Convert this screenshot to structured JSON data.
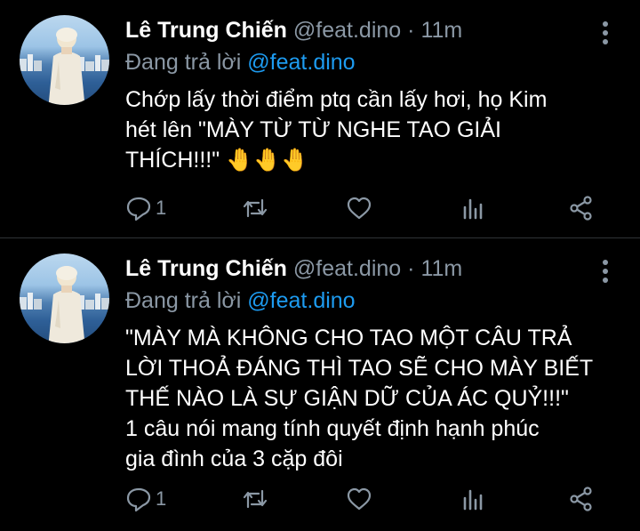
{
  "tweets": [
    {
      "author_name": "Lê Trung Chiến",
      "handle": "@feat.dino",
      "separator": "·",
      "time": "11m",
      "reply_prefix": "Đang trả lời",
      "reply_mention": "@feat.dino",
      "lines": [
        "Chớp lấy thời điểm ptq cần lấy hơi, họ Kim",
        "hét lên \"MÀY TỪ TỪ NGHE TAO GIẢI",
        "THÍCH!!!\" 🤚🤚🤚"
      ],
      "reply_count": "1"
    },
    {
      "author_name": "Lê Trung Chiến",
      "handle": "@feat.dino",
      "separator": "·",
      "time": "11m",
      "reply_prefix": "Đang trả lời",
      "reply_mention": "@feat.dino",
      "lines": [
        "\"MÀY MÀ KHÔNG CHO TAO MỘT CÂU TRẢ",
        "LỜI THOẢ ĐÁNG THÌ TAO SẼ CHO MÀY BIẾT",
        "THẾ NÀO LÀ SỰ GIẬN DỮ CỦA ÁC QUỶ!!!\"",
        "1 câu nói mang tính quyết định hạnh phúc",
        "gia đình của 3 cặp đôi"
      ],
      "reply_count": "1"
    }
  ],
  "icons": {
    "reply": "reply-icon",
    "retweet": "retweet-icon",
    "like": "heart-icon",
    "stats": "analytics-icon",
    "share": "share-icon",
    "more": "more-vertical-icon"
  },
  "colors": {
    "background": "#000000",
    "secondary_text": "#8b98a5",
    "link": "#1d9bf0",
    "divider": "#2f3336"
  }
}
